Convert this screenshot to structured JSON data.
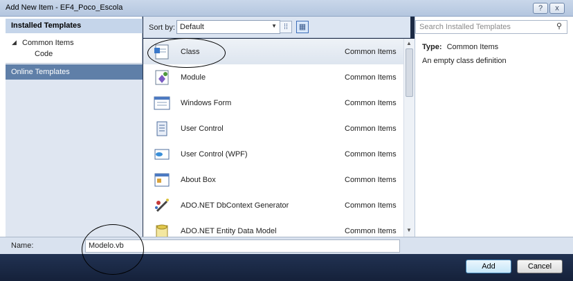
{
  "window": {
    "title": "Add New Item - EF4_Poco_Escola",
    "help_glyph": "?",
    "close_glyph": "x"
  },
  "sidebar": {
    "header": "Installed Templates",
    "tree": [
      {
        "label": "Common Items"
      },
      {
        "label": "Code"
      }
    ],
    "online": "Online Templates"
  },
  "toolbar": {
    "sort_label": "Sort by:",
    "sort_value": "Default"
  },
  "templates": [
    {
      "name": "Class",
      "category": "Common Items",
      "icon": "class-icon"
    },
    {
      "name": "Module",
      "category": "Common Items",
      "icon": "module-icon"
    },
    {
      "name": "Windows Form",
      "category": "Common Items",
      "icon": "windows-form-icon"
    },
    {
      "name": "User Control",
      "category": "Common Items",
      "icon": "user-control-icon"
    },
    {
      "name": "User Control (WPF)",
      "category": "Common Items",
      "icon": "user-control-wpf-icon"
    },
    {
      "name": "About Box",
      "category": "Common Items",
      "icon": "about-box-icon"
    },
    {
      "name": "ADO.NET DbContext Generator",
      "category": "Common Items",
      "icon": "dbcontext-generator-icon"
    },
    {
      "name": "ADO.NET Entity Data Model",
      "category": "Common Items",
      "icon": "entity-data-model-icon"
    }
  ],
  "details": {
    "search_placeholder": "Search Installed Templates",
    "type_label": "Type:",
    "type_value": "Common Items",
    "description": "An empty class definition"
  },
  "name_field": {
    "label": "Name:",
    "value": "Modelo.vb"
  },
  "buttons": {
    "add": "Add",
    "cancel": "Cancel"
  },
  "colors": {
    "selected_tree_bg": "#5f7fa8",
    "header_bg": "#c5d5ea",
    "footer_bg": "#1d2b45"
  }
}
